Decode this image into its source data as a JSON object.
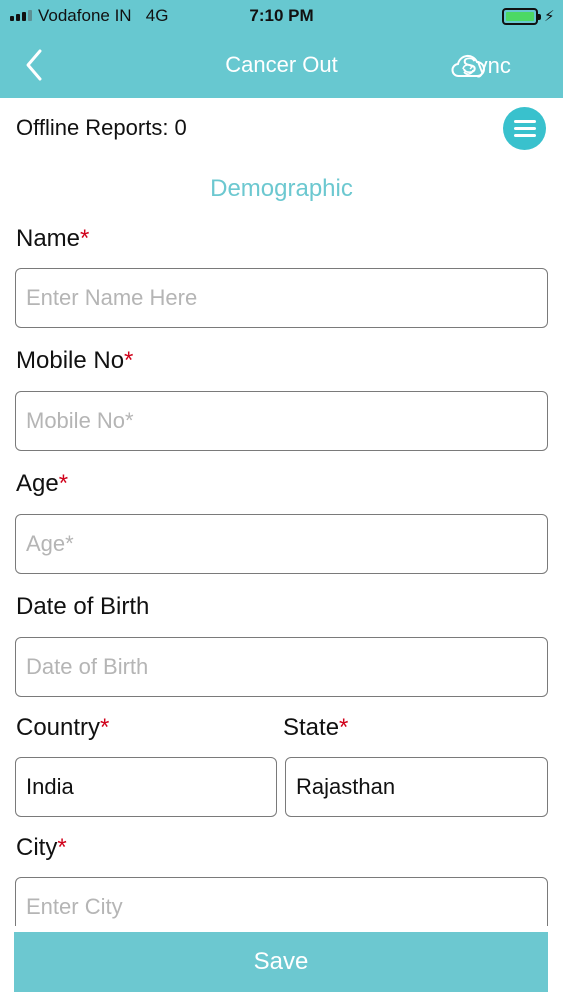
{
  "status_bar": {
    "carrier": "Vodafone IN",
    "network": "4G",
    "time": "7:10 PM",
    "battery_level": 1.0
  },
  "nav": {
    "back_icon": "chevron-left-icon",
    "title": "Cancer Out",
    "sync_label": "Sync",
    "sync_icon": "cloud-sync-icon"
  },
  "offline_reports": "Offline Reports: 0",
  "menu_icon": "hamburger-menu-icon",
  "section_title": "Demographic",
  "required_mark": "*",
  "fields": {
    "name": {
      "label": "Name",
      "placeholder": "Enter Name Here",
      "value": ""
    },
    "mobile": {
      "label": "Mobile No",
      "placeholder": "Mobile No*",
      "value": ""
    },
    "age": {
      "label": "Age",
      "placeholder": "Age*",
      "value": ""
    },
    "dob": {
      "label": "Date of Birth",
      "placeholder": "Date of Birth",
      "value": ""
    },
    "country": {
      "label": "Country",
      "value": "India"
    },
    "state": {
      "label": "State",
      "value": "Rajasthan"
    },
    "city": {
      "label": "City",
      "placeholder": "Enter City",
      "value": ""
    }
  },
  "save_label": "Save",
  "colors": {
    "accent": "#67c8d0",
    "menu_button": "#39c1cd",
    "required": "#d0021b"
  }
}
